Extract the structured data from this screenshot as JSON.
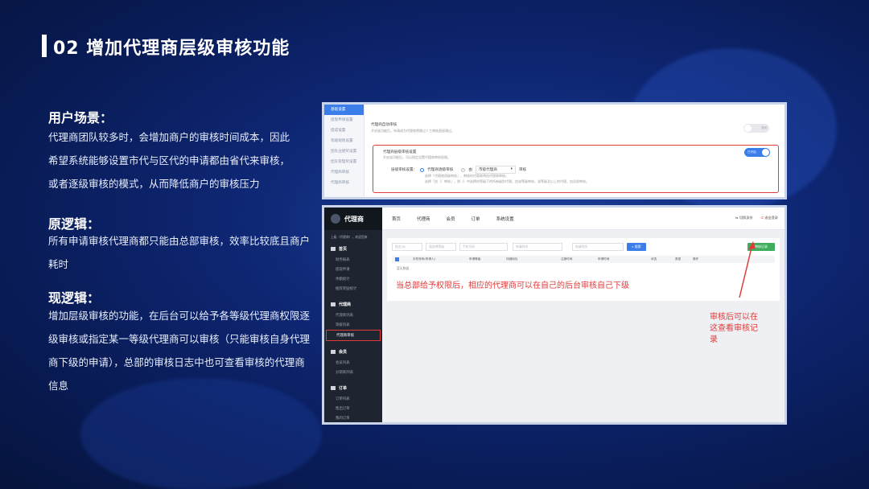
{
  "title": "02 增加代理商层级审核功能",
  "sections": {
    "scenario": {
      "heading": "用户场景：",
      "lines": [
        "代理商团队较多时，会增加商户的审核时间成本，因此",
        "希望系统能够设置市代与区代的申请都由省代来审核，",
        "或者逐级审核的模式，从而降低商户的审核压力"
      ]
    },
    "old_logic": {
      "heading": "原逻辑：",
      "lines": [
        "所有申请审核代理商都只能由总部审核，效率比较底且商户",
        "耗时"
      ]
    },
    "new_logic": {
      "heading": "现逻辑：",
      "lines": [
        "增加层级审核的功能，在后台可以给予各等级代理商权限逐",
        "级审核或指定某一等级代理商可以审核（只能审核自身代理",
        "商下级的申请），总部的审核日志中也可查看审核的代理商",
        "信息"
      ]
    }
  },
  "screenshot1": {
    "sidebar": [
      "基础设置",
      "提现申请设置",
      "提成设置",
      "等级规则设置",
      "团队业绩奖设置",
      "团队管理奖设置",
      "代理商审核",
      "代理商审核"
    ],
    "row1": {
      "title": "代理商自动审核",
      "desc": "开启该功能后，申请成为代理商将跳过人工审核直接通过。",
      "toggle": "关闭"
    },
    "box": {
      "title": "代理商层级审核设置",
      "desc": "开启该功能后，可以指定设置代理商审核权限。",
      "toggle": "已开启",
      "label": "层级审核设置：",
      "opt1": "代理商逐级审核",
      "opt2": "由",
      "select": "市级代理商",
      "opt2_tail": "审核",
      "note1": "选择「代理商逐级审核」，审核时代理商将由代理商审核。",
      "note2": "选择「由（）审核」，则（）中选择的等级下的所有级别代理，由该等级审核，该等级及以上的代理，由总部审核。"
    }
  },
  "screenshot2": {
    "logo": "代理商",
    "user": "上级（代理商），欢迎您来",
    "nav": [
      "首页",
      "代理商",
      "会员",
      "订单",
      "系统设置"
    ],
    "top_right": [
      "切换身份",
      "退出登录"
    ],
    "menu": [
      {
        "group": "首页",
        "items": [
          "财务报表",
          "提现申请",
          "余额统计",
          "推荐奖励统计"
        ]
      },
      {
        "group": "代理商",
        "items": [
          "代理商列表",
          "等级列表",
          "代理商审核"
        ]
      },
      {
        "group": "会员",
        "items": [
          "会员列表",
          "分销商列表"
        ]
      },
      {
        "group": "订单",
        "items": [
          "订单列表",
          "售出订单",
          "我的订单"
        ]
      }
    ],
    "filters": [
      "姓名/ID",
      "请选择等级",
      "手机号码",
      "申请时间",
      "申请时间"
    ],
    "search_btn": "搜索",
    "record_btn": "审核记录",
    "table_headers": [
      "手机号码(申请人)",
      "申请等级",
      "详细地址",
      "注册时间",
      "申请时间",
      "状态",
      "类型",
      "操作"
    ],
    "empty_text": "暂无数据"
  },
  "annotations": {
    "main": "当总部给予权限后，相应的代理商可以在自己的后台审核自己下级",
    "side": [
      "审核后可以在",
      "这查看审核记",
      "录"
    ]
  },
  "colors": {
    "accent_red": "#e03b3b",
    "accent_blue": "#3b7de9",
    "green": "#3fae5c"
  }
}
